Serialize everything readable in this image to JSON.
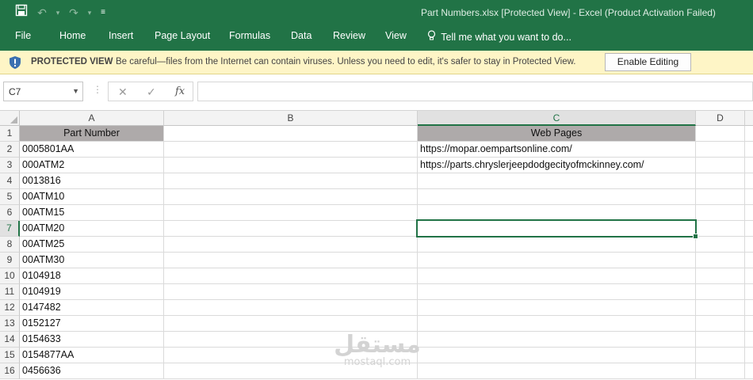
{
  "window": {
    "title": "Part Numbers.xlsx  [Protected View] - Excel (Product Activation Failed)"
  },
  "qat": {
    "save_icon": "save-icon",
    "undo_icon": "undo-icon",
    "redo_icon": "redo-icon",
    "customize_icon": "customize-icon"
  },
  "ribbon": {
    "tabs": [
      "File",
      "Home",
      "Insert",
      "Page Layout",
      "Formulas",
      "Data",
      "Review",
      "View"
    ],
    "tell_me": "Tell me what you want to do..."
  },
  "protected_view": {
    "title": "PROTECTED VIEW",
    "message": "Be careful—files from the Internet can contain viruses. Unless you need to edit, it's safer to stay in Protected View.",
    "button": "Enable Editing"
  },
  "formula_bar": {
    "name_box": "C7",
    "content": ""
  },
  "sheet": {
    "columns": [
      "A",
      "B",
      "C",
      "D"
    ],
    "selected_column": "C",
    "selected_row": "7",
    "rows": [
      {
        "num": "1",
        "a": "Part Number",
        "c": "Web Pages"
      },
      {
        "num": "2",
        "a": "0005801AA",
        "c": "https://mopar.oempartsonline.com/"
      },
      {
        "num": "3",
        "a": "000ATM2",
        "c": "https://parts.chryslerjeepdodgecityofmckinney.com/"
      },
      {
        "num": "4",
        "a": "0013816",
        "c": ""
      },
      {
        "num": "5",
        "a": "00ATM10",
        "c": ""
      },
      {
        "num": "6",
        "a": "00ATM15",
        "c": ""
      },
      {
        "num": "7",
        "a": "00ATM20",
        "c": ""
      },
      {
        "num": "8",
        "a": "00ATM25",
        "c": ""
      },
      {
        "num": "9",
        "a": "00ATM30",
        "c": ""
      },
      {
        "num": "10",
        "a": "0104918",
        "c": ""
      },
      {
        "num": "11",
        "a": "0104919",
        "c": ""
      },
      {
        "num": "12",
        "a": "0147482",
        "c": ""
      },
      {
        "num": "13",
        "a": "0152127",
        "c": ""
      },
      {
        "num": "14",
        "a": "0154633",
        "c": ""
      },
      {
        "num": "15",
        "a": "0154877AA",
        "c": ""
      },
      {
        "num": "16",
        "a": "0456636",
        "c": ""
      }
    ]
  },
  "watermark": {
    "arabic": "مستقل",
    "latin": "mostaql.com"
  },
  "colors": {
    "accent": "#217346",
    "header_fill": "#aeaaaa",
    "protected_bar": "#fef5c6"
  }
}
